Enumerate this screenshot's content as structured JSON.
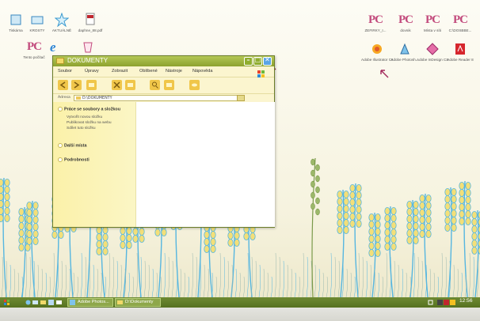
{
  "desktop": {
    "icons_left": [
      {
        "label": "Tiskárna",
        "icon": "printer-icon"
      },
      {
        "label": "KROSTY",
        "icon": "folder-icon"
      },
      {
        "label": "AKTUÁLNĚ",
        "icon": "star-icon"
      },
      {
        "label": "daphne_88.pdf",
        "icon": "pdf-icon"
      },
      {
        "label": "Tento počítač",
        "icon": "computer-icon"
      },
      {
        "label": "",
        "icon": "internet-explorer-icon"
      },
      {
        "label": "",
        "icon": "recycle-bin-icon"
      }
    ],
    "icons_right": [
      {
        "label": "ZEFIRKY_I...",
        "icon": "pc-icon"
      },
      {
        "label": "dovnik",
        "icon": "pc-icon"
      },
      {
        "label": "Místa v síti",
        "icon": "pc-icon"
      },
      {
        "label": "C:\\DOSBBE...",
        "icon": "pc-icon"
      },
      {
        "label": "Adobe Illustrator CS3",
        "icon": "illustrator-icon"
      },
      {
        "label": "Adobe Photosh...",
        "icon": "photoshop-icon"
      },
      {
        "label": "Adobe InDesign CS3",
        "icon": "indesign-icon"
      },
      {
        "label": "Adobe Reader 8",
        "icon": "adobe-reader-icon"
      }
    ],
    "pc_glyph": "PC"
  },
  "window": {
    "title": "DOKUMENTY",
    "menu": [
      "Soubor",
      "Úpravy",
      "Zobrazit",
      "Oblíbené",
      "Nástroje",
      "Nápověda"
    ],
    "address_label": "Adresa",
    "address_value": "D:\\DOKUMENTY",
    "sections": {
      "files": {
        "title": "Práce se soubory a složkou",
        "tasks": [
          "Vytvořit novou složku",
          "Publikovat složku na webu",
          "Sdílet tuto složku"
        ]
      },
      "other": {
        "title": "Další místa"
      },
      "details": {
        "title": "Podrobnosti"
      }
    }
  },
  "taskbar": {
    "buttons": [
      {
        "label": "Adobe Photos...",
        "icon": "photoshop-icon"
      },
      {
        "label": "D:\\Dokumenty",
        "icon": "folder-icon"
      }
    ],
    "clock": "12:56"
  },
  "colors": {
    "accent": "#8da22e",
    "pc_pink": "#c24a7c",
    "wheat_blue": "#56b6e0",
    "wheat_yellow": "#f3df79"
  }
}
